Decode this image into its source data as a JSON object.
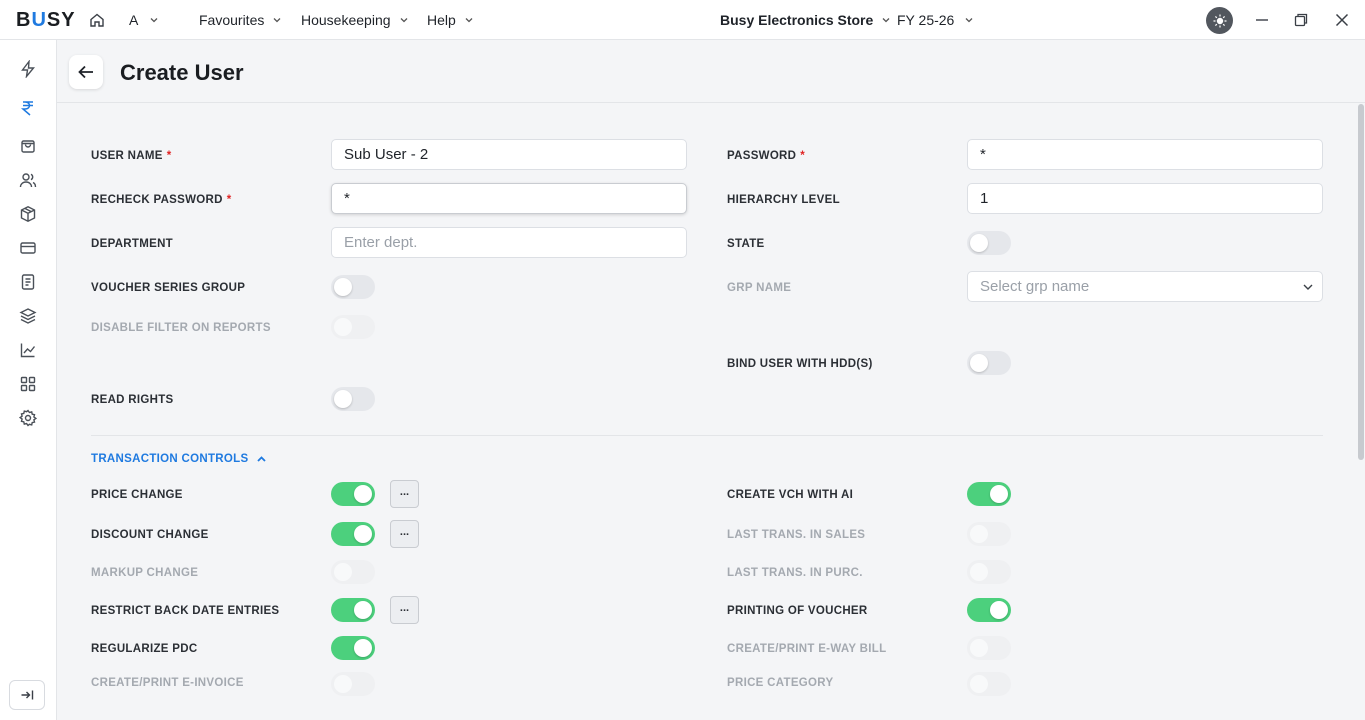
{
  "topbar": {
    "logo": "BUSY",
    "logo_left": "B",
    "logo_accent": "U",
    "logo_right": "SY",
    "company_initial": "A",
    "menu": [
      "Favourites",
      "Housekeeping",
      "Help"
    ],
    "company": "Busy Electronics Store",
    "fy": "FY 25-26"
  },
  "page": {
    "title": "Create User"
  },
  "form": {
    "user_name_label": "USER NAME",
    "user_name_value": "Sub User - 2",
    "password_label": "PASSWORD",
    "password_value": "*",
    "recheck_password_label": "RECHECK PASSWORD",
    "recheck_password_value": "*",
    "hierarchy_level_label": "HIERARCHY LEVEL",
    "hierarchy_level_value": "1",
    "department_label": "DEPARTMENT",
    "department_placeholder": "Enter dept.",
    "state_label": "STATE",
    "voucher_series_group_label": "VOUCHER SERIES GROUP",
    "grp_name_label": "GRP NAME",
    "grp_name_placeholder": "Select grp name",
    "disable_filter_label": "DISABLE FILTER ON REPORTS",
    "bind_user_hdd_label": "BIND USER WITH HDD(S)",
    "read_rights_label": "READ RIGHTS",
    "required_mark": "*"
  },
  "transaction_controls": {
    "title": "TRANSACTION CONTROLS",
    "more_label": "...",
    "left": [
      {
        "label": "PRICE CHANGE",
        "state": "on",
        "more": true
      },
      {
        "label": "DISCOUNT CHANGE",
        "state": "on",
        "more": true
      },
      {
        "label": "MARKUP CHANGE",
        "state": "disabled",
        "more": false
      },
      {
        "label": "RESTRICT BACK DATE ENTRIES",
        "state": "on",
        "more": true
      },
      {
        "label": "REGULARIZE PDC",
        "state": "on",
        "more": false
      },
      {
        "label": "CREATE/PRINT E-INVOICE",
        "state": "disabled",
        "more": false
      }
    ],
    "right": [
      {
        "label": "CREATE VCH WITH AI",
        "state": "on"
      },
      {
        "label": "LAST TRANS. IN SALES",
        "state": "disabled"
      },
      {
        "label": "LAST TRANS. IN PURC.",
        "state": "disabled"
      },
      {
        "label": "PRINTING OF VOUCHER",
        "state": "on"
      },
      {
        "label": "CREATE/PRINT E-WAY BILL",
        "state": "disabled"
      },
      {
        "label": "PRICE CATEGORY",
        "state": "disabled"
      }
    ]
  },
  "toggles": {
    "state": "off",
    "voucher_series_group": "off",
    "disable_filter_on_reports": "disabled",
    "bind_user_with_hdd": "off",
    "read_rights": "off"
  },
  "colors": {
    "accent": "#1f7ae0",
    "toggle_on": "#4cd07d",
    "required": "#e02424"
  },
  "icons": {
    "sidebar": [
      "bolt-icon",
      "rupee-icon",
      "shopping-bag-icon",
      "users-icon",
      "box-icon",
      "credit-card-icon",
      "document-icon",
      "layers-icon",
      "chart-icon",
      "grid-icon",
      "gear-icon"
    ]
  }
}
